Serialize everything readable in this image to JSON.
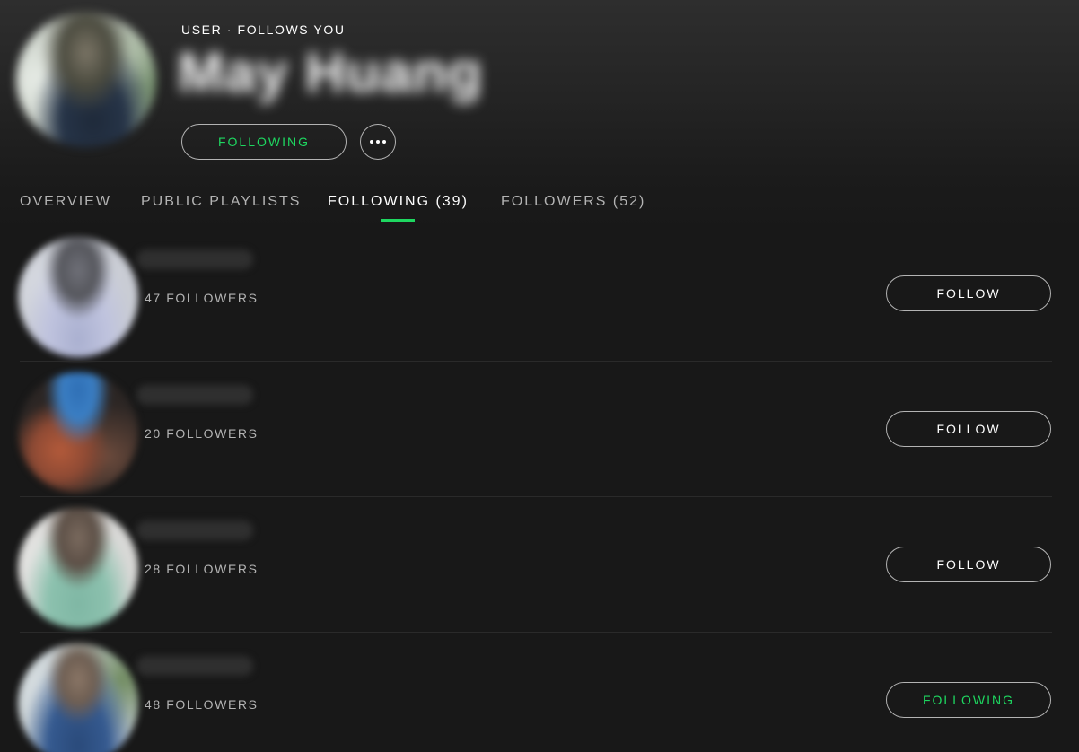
{
  "header": {
    "user_type": "USER · FOLLOWS YOU",
    "name": "May Huang",
    "follow_button": "FOLLOWING",
    "more_icon": "more-options-icon"
  },
  "tabs": [
    {
      "label": "OVERVIEW",
      "active": false
    },
    {
      "label": "PUBLIC PLAYLISTS",
      "active": false
    },
    {
      "label": "FOLLOWING (39)",
      "active": true
    },
    {
      "label": "FOLLOWERS (52)",
      "active": false
    }
  ],
  "list": {
    "items": [
      {
        "followers": "47 FOLLOWERS",
        "button": "FOLLOW"
      },
      {
        "followers": "20 FOLLOWERS",
        "button": "FOLLOW"
      },
      {
        "followers": "28 FOLLOWERS",
        "button": "FOLLOW"
      },
      {
        "followers": "48 FOLLOWERS",
        "button": "FOLLOWING"
      }
    ]
  },
  "colors": {
    "accent": "#1ed760",
    "background": "#181818",
    "text_secondary": "#b3b3b3"
  }
}
